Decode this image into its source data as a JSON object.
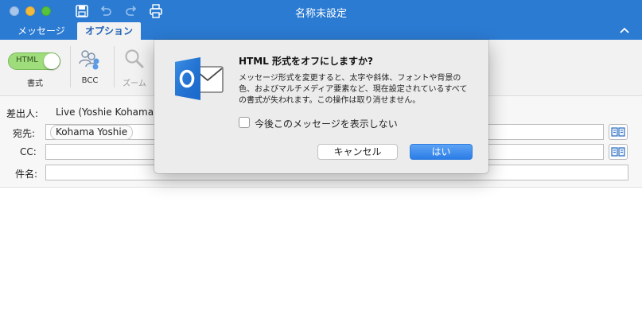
{
  "window": {
    "title": "名称未設定"
  },
  "toolbar": {
    "save_icon": "save-icon",
    "undo_icon": "undo-icon",
    "redo_icon": "redo-icon",
    "print_icon": "print-icon"
  },
  "tabs": [
    {
      "label": "メッセージ",
      "active": false
    },
    {
      "label": "オプション",
      "active": true
    }
  ],
  "ribbon": {
    "html_toggle_label": "HTML",
    "format_label": "書式",
    "bcc_label": "BCC",
    "zoom_label": "ズーム"
  },
  "form": {
    "from_label": "差出人:",
    "from_value": "Live (Yoshie Kohama",
    "to_label": "宛先:",
    "to_chip": "Kohama Yoshie",
    "cc_label": "CC:",
    "subject_label": "件名:"
  },
  "dialog": {
    "title": "HTML 形式をオフにしますか?",
    "body": "メッセージ形式を変更すると、太字や斜体、フォントや背景の色、およびマルチメディア要素など、現在設定されているすべての書式が失われます。この操作は取り消せません。",
    "checkbox_label": "今後このメッセージを表示しない",
    "cancel_label": "キャンセル",
    "yes_label": "はい"
  },
  "colors": {
    "titlebar": "#2b7bd3",
    "accent_button": "#2b7de6",
    "toggle_on": "#9fdc7c",
    "outlook_blue": "#1f6fd1"
  }
}
